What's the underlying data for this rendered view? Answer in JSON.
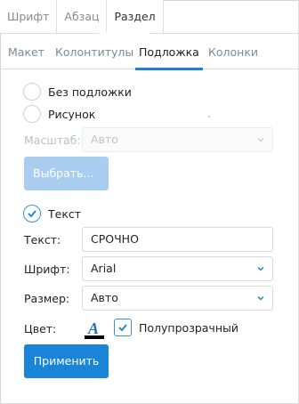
{
  "top_tabs": [
    {
      "label": "Шрифт",
      "active": false
    },
    {
      "label": "Абзац",
      "active": false
    },
    {
      "label": "Раздел",
      "active": true
    }
  ],
  "sub_tabs": [
    {
      "label": "Макет",
      "active": false
    },
    {
      "label": "Колонтитулы",
      "active": false
    },
    {
      "label": "Подложка",
      "active": true
    },
    {
      "label": "Колонки",
      "active": false
    }
  ],
  "watermark": {
    "none_label": "Без подложки",
    "picture_label": "Рисунок",
    "scale_label": "Масштаб:",
    "scale_value": "Авто",
    "choose_button": "Выбрать...",
    "text_option_label": "Текст",
    "text_label": "Текст:",
    "text_value": "СРОЧНО",
    "font_label": "Шрифт:",
    "font_value": "Arial",
    "size_label": "Размер:",
    "size_value": "Авто",
    "color_label": "Цвет:",
    "color_icon": "font-color-icon",
    "color_value": "#000000",
    "semi_transparent_label": "Полупрозрачный",
    "semi_transparent_checked": true,
    "apply_button": "Применить"
  },
  "colors": {
    "accent": "#1a85d6",
    "accent_disabled": "#a8cdee"
  }
}
